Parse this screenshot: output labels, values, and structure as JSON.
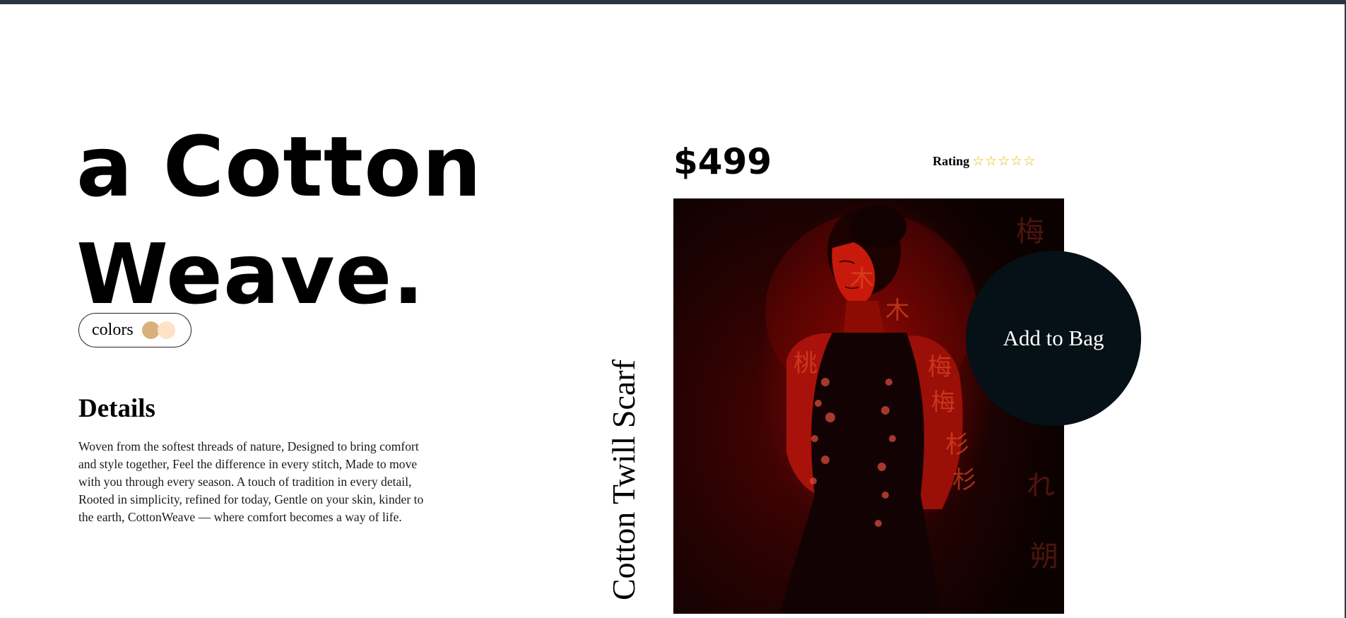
{
  "hero": {
    "title_line1": "a Cotton",
    "title_line2": "Weave."
  },
  "colors": {
    "label": "colors",
    "swatches": [
      "#d8b07e",
      "#fde2c4"
    ]
  },
  "details": {
    "heading": "Details",
    "body": "Woven from the softest threads of nature, Designed to bring comfort and style together, Feel the difference in every stitch, Made to move with you through every season. A touch of tradition in every detail, Rooted in simplicity, refined for today, Gentle on your skin, kinder to the earth, CottonWeave — where comfort becomes a way of life."
  },
  "product": {
    "price": "$499",
    "name": "Cotton Twill Scarf",
    "rating_label": "Rating",
    "rating_value": 0,
    "rating_max": 5,
    "star_glyph": "☆",
    "add_to_bag": "Add to Bag",
    "image_alt": "woman in dark dress lit by red light with projected characters"
  },
  "theme": {
    "star_color": "#e6b800",
    "button_bg": "#061117",
    "top_bar": "#2b3340"
  }
}
